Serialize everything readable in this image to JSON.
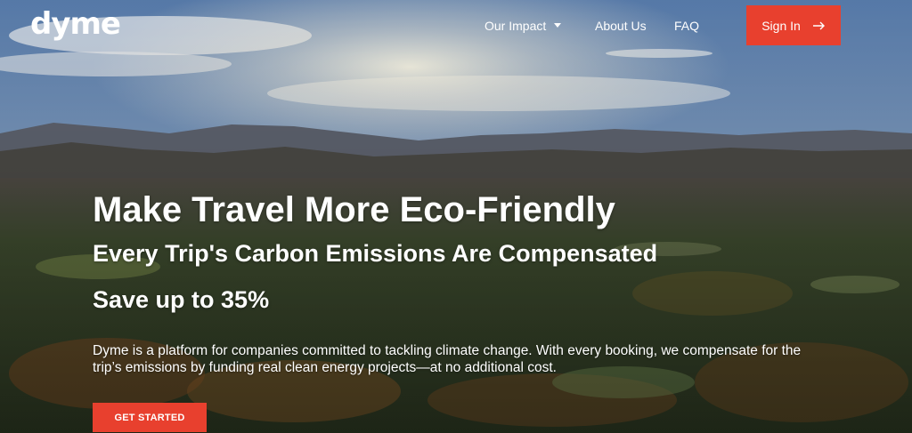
{
  "brand": {
    "logo_text": "dyme"
  },
  "nav": {
    "items": [
      {
        "label": "Our Impact",
        "has_dropdown": true,
        "icon": "chevron-down-icon"
      },
      {
        "label": "About Us",
        "has_dropdown": false
      },
      {
        "label": "FAQ",
        "has_dropdown": false
      }
    ],
    "signin": {
      "label": "Sign In",
      "icon": "arrow-right-icon"
    }
  },
  "hero": {
    "title": "Make Travel More Eco-Friendly",
    "subtitle": "Every Trip's Carbon Emissions Are Compensated",
    "savings": "Save up to 35%",
    "description": "Dyme is a platform for companies committed to tackling climate change. With every booking, we compensate for the trip’s emissions by funding real clean energy projects—at no additional cost.",
    "cta_label": "GET STARTED",
    "background": "aerial-mountain-forest-photo"
  },
  "colors": {
    "accent": "#e8402e",
    "text": "#ffffff"
  }
}
